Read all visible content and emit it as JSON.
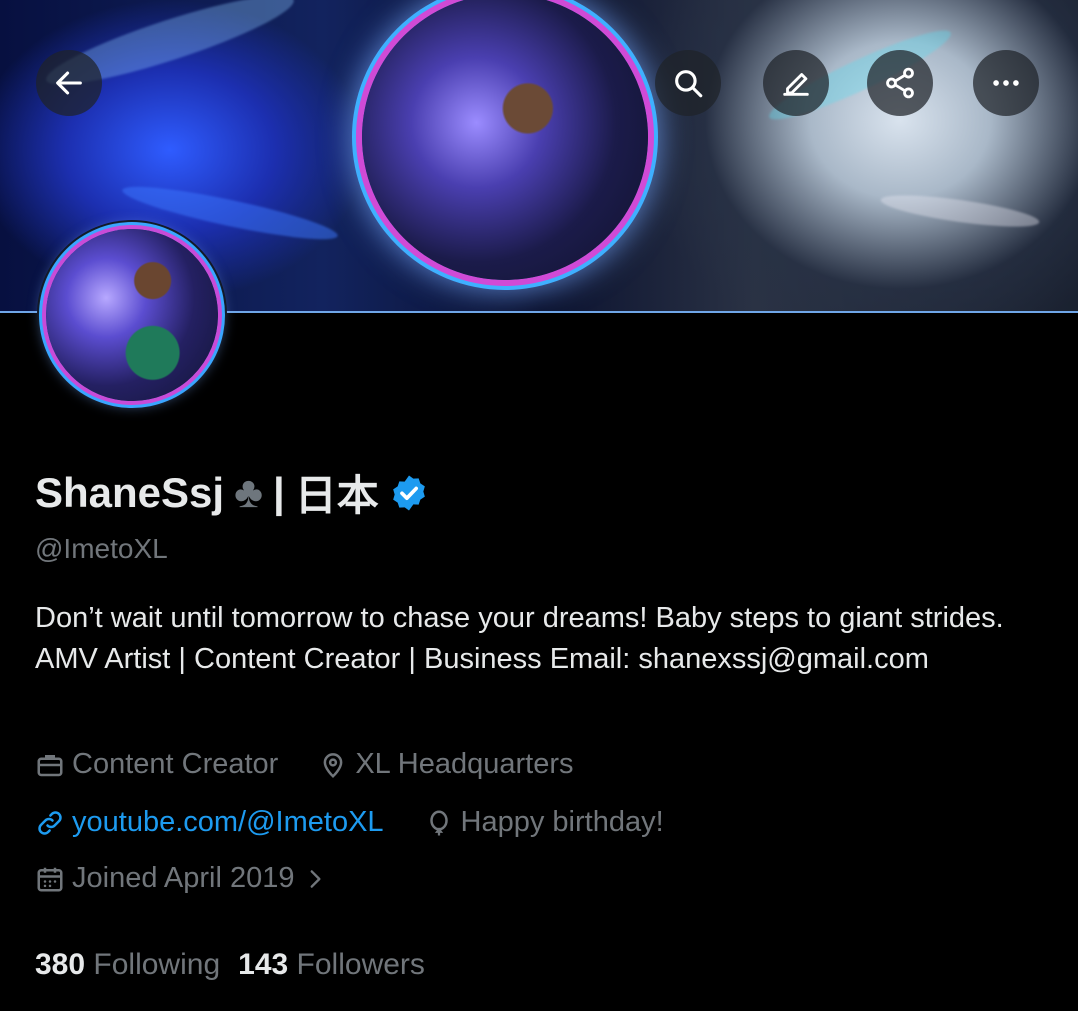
{
  "header": {
    "back_icon": "arrow-left-icon",
    "search_icon": "search-icon",
    "edit_icon": "pencil-icon",
    "share_icon": "share-icon",
    "more_icon": "more-horizontal-icon"
  },
  "profile": {
    "display_name": "ShaneSsj",
    "club_symbol": "♣",
    "separator": "|",
    "country_text": "日本",
    "verified": true,
    "handle": "@ImetoXL",
    "bio": "Don’t wait until tomorrow to chase your dreams! Baby steps to giant strides. AMV Artist | Content Creator | Business Email: shanexssj@gmail.com",
    "category": "Content Creator",
    "location": "XL Headquarters",
    "website": "youtube.com/@ImetoXL",
    "birthday": "Happy birthday!",
    "joined": "Joined April 2019"
  },
  "stats": {
    "following_count": "380",
    "following_label": "Following",
    "followers_count": "143",
    "followers_label": "Followers"
  },
  "colors": {
    "background": "#000000",
    "text_primary": "#e7e9ea",
    "text_secondary": "#71767b",
    "link": "#1d9bf0",
    "verified": "#1d9bf0"
  }
}
